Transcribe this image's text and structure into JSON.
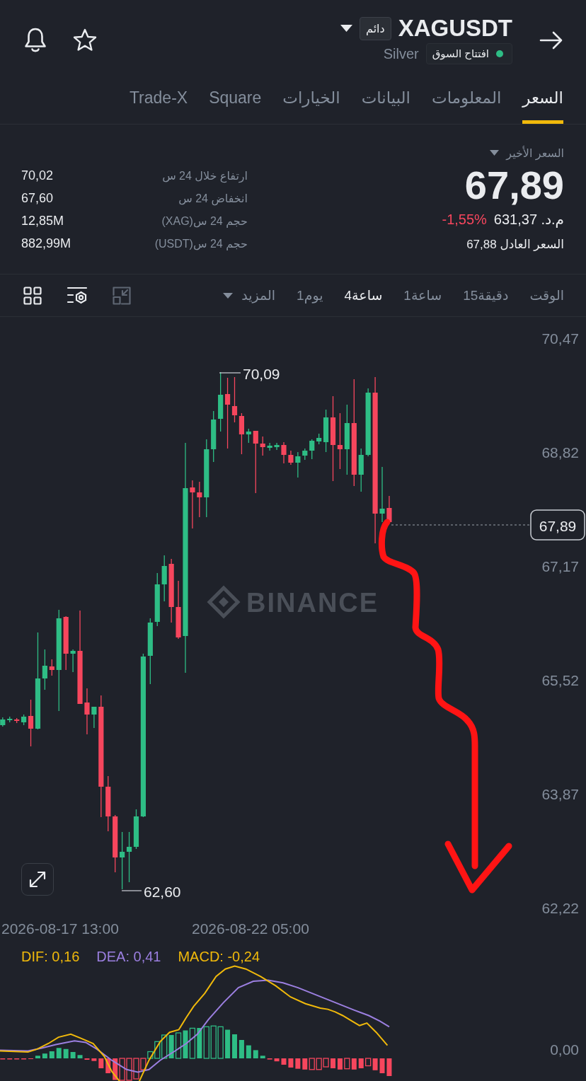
{
  "header": {
    "symbol": "XAGUSDT",
    "contract_badge": "دائم",
    "name": "Silver",
    "market_status": {
      "text": "افتتاح السوق",
      "open": true
    }
  },
  "tabs": [
    {
      "label": "السعر",
      "selected": true
    },
    {
      "label": "المعلومات",
      "selected": false
    },
    {
      "label": "البيانات",
      "selected": false
    },
    {
      "label": "الخيارات",
      "selected": false
    },
    {
      "label": "Square",
      "selected": false
    },
    {
      "label": "Trade-X",
      "selected": false
    }
  ],
  "price": {
    "label": "السعر الأخير",
    "last": "67,89",
    "local_value": "م.د. 631,37",
    "change": "-1,55%",
    "falling": true,
    "fair_price": "السعر العادل 67,88"
  },
  "stats": [
    {
      "label": "ارتفاع خلال 24 س",
      "value": "70,02"
    },
    {
      "label": "انخفاض 24 س",
      "value": "67,60"
    },
    {
      "label": "حجم 24 س(XAG)",
      "value": "12,85M"
    },
    {
      "label": "حجم 24 س(USDT)",
      "value": "882,99M"
    }
  ],
  "intervals": [
    {
      "label": "الوقت",
      "selected": false
    },
    {
      "label": "دقيقة15",
      "selected": false
    },
    {
      "label": "ساعة1",
      "selected": false
    },
    {
      "label": "ساعة4",
      "selected": true
    },
    {
      "label": "يوم1",
      "selected": false
    }
  ],
  "more_menu": "المزيد",
  "chart_tools": [
    {
      "kind": "layout",
      "disabled": false
    },
    {
      "kind": "settings",
      "disabled": false
    },
    {
      "kind": "minimize",
      "disabled": true
    }
  ],
  "chart": {
    "watermark": "BINANCE",
    "price_axis": [
      "70,47",
      "68,82",
      "67,17",
      "65,52",
      "63,87",
      "62,22"
    ],
    "time_axis": [
      "2026-08-22 05:00",
      "2026-08-17 13:00"
    ],
    "high_label": "70,09",
    "low_label": "62,60",
    "last_price_tag": "67,89"
  },
  "macd": {
    "legend": [
      {
        "text": "MACD: -0,24",
        "color": "#f0b90b"
      },
      {
        "text": "DEA: 0,41",
        "color": "#9b7fe0"
      },
      {
        "text": "DIF: 0,16",
        "color": "#f0b90b"
      }
    ],
    "axis_label": "0,00"
  }
}
